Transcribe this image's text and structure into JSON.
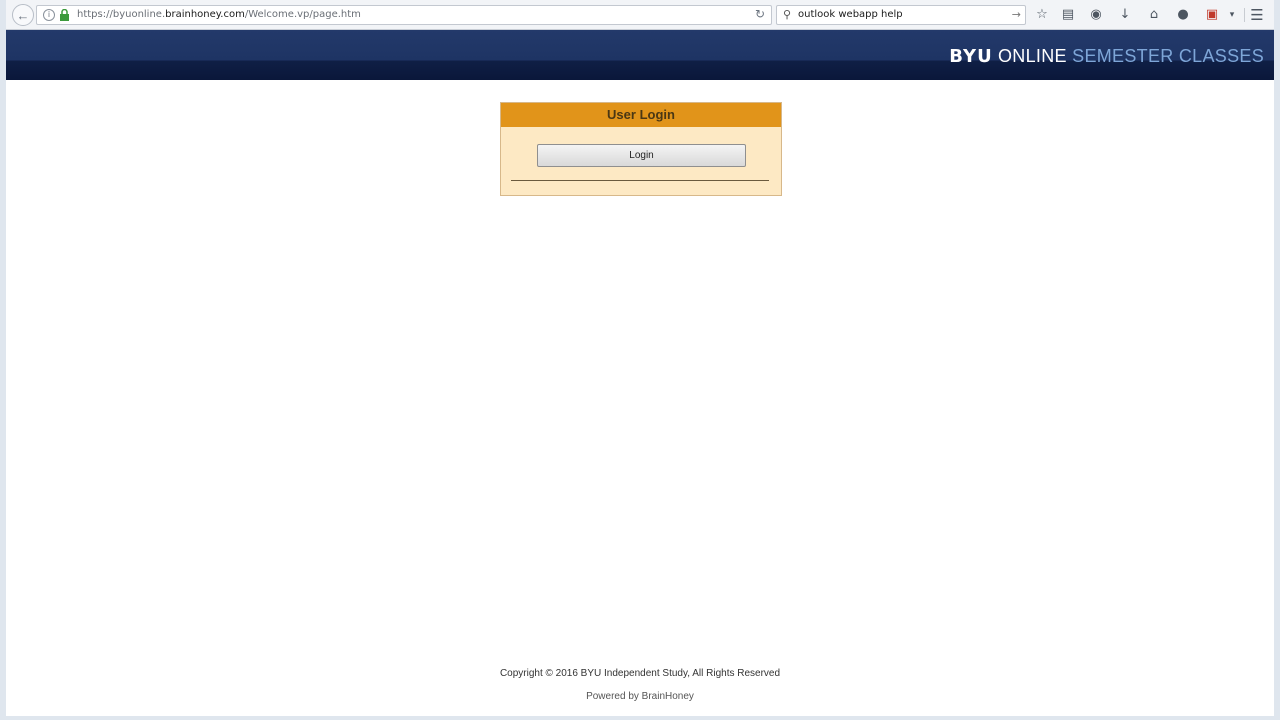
{
  "browser": {
    "url_prefix": "https://byuonline.",
    "url_domain": "brainhoney.com",
    "url_path": "/Welcome.vp/page.htm",
    "search_value": "outlook webapp help",
    "icons": [
      "back-arrow-icon",
      "info-icon",
      "lock-icon",
      "reload-icon",
      "search-icon",
      "go-arrow-icon",
      "bookmark-star-icon",
      "reading-list-icon",
      "pocket-icon",
      "download-icon",
      "home-icon",
      "chat-icon",
      "pdf-icon",
      "dropdown-icon",
      "hamburger-menu-icon"
    ]
  },
  "banner": {
    "byu": "BYU",
    "online": "ONLINE",
    "semester": "SEMESTER CLASSES",
    "colors": {
      "bg": "#1e3464",
      "accent": "#7ea6d8"
    }
  },
  "login": {
    "title": "User Login",
    "button_label": "Login",
    "colors": {
      "header": "#e1941a",
      "panel": "#fde9c4"
    }
  },
  "footer": {
    "copyright": "Copyright © 2016 BYU Independent Study, All Rights Reserved",
    "powered": "Powered by BrainHoney"
  }
}
